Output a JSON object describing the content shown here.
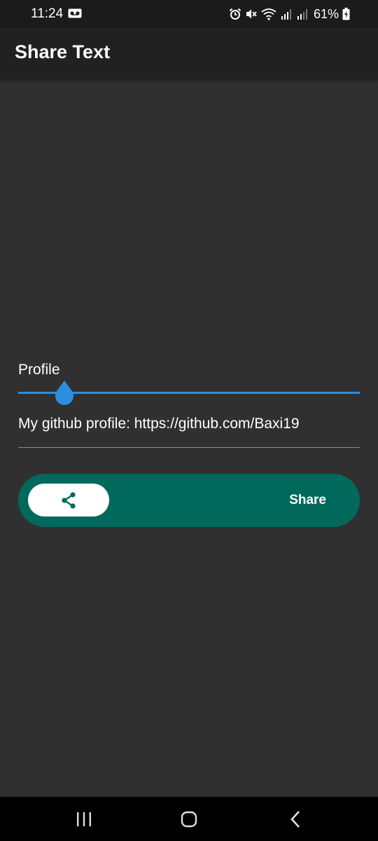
{
  "status_bar": {
    "time": "11:24",
    "battery": "61%",
    "icons": [
      "voicemail-icon",
      "alarm-icon",
      "mute-icon",
      "wifi-icon",
      "signal-icon",
      "signal-icon",
      "battery-charging-icon"
    ]
  },
  "app_bar": {
    "title": "Share Text"
  },
  "slider": {
    "label": "Profile",
    "value_fraction": 0.135,
    "color": "#2d8ee0"
  },
  "text_field": {
    "value": "My github profile: https://github.com/Baxi19"
  },
  "share_bar": {
    "icon": "share-icon",
    "label": "Share",
    "color": "#00695c"
  },
  "nav_bar": {
    "icons": [
      "recent-apps-icon",
      "home-icon",
      "back-icon"
    ]
  }
}
